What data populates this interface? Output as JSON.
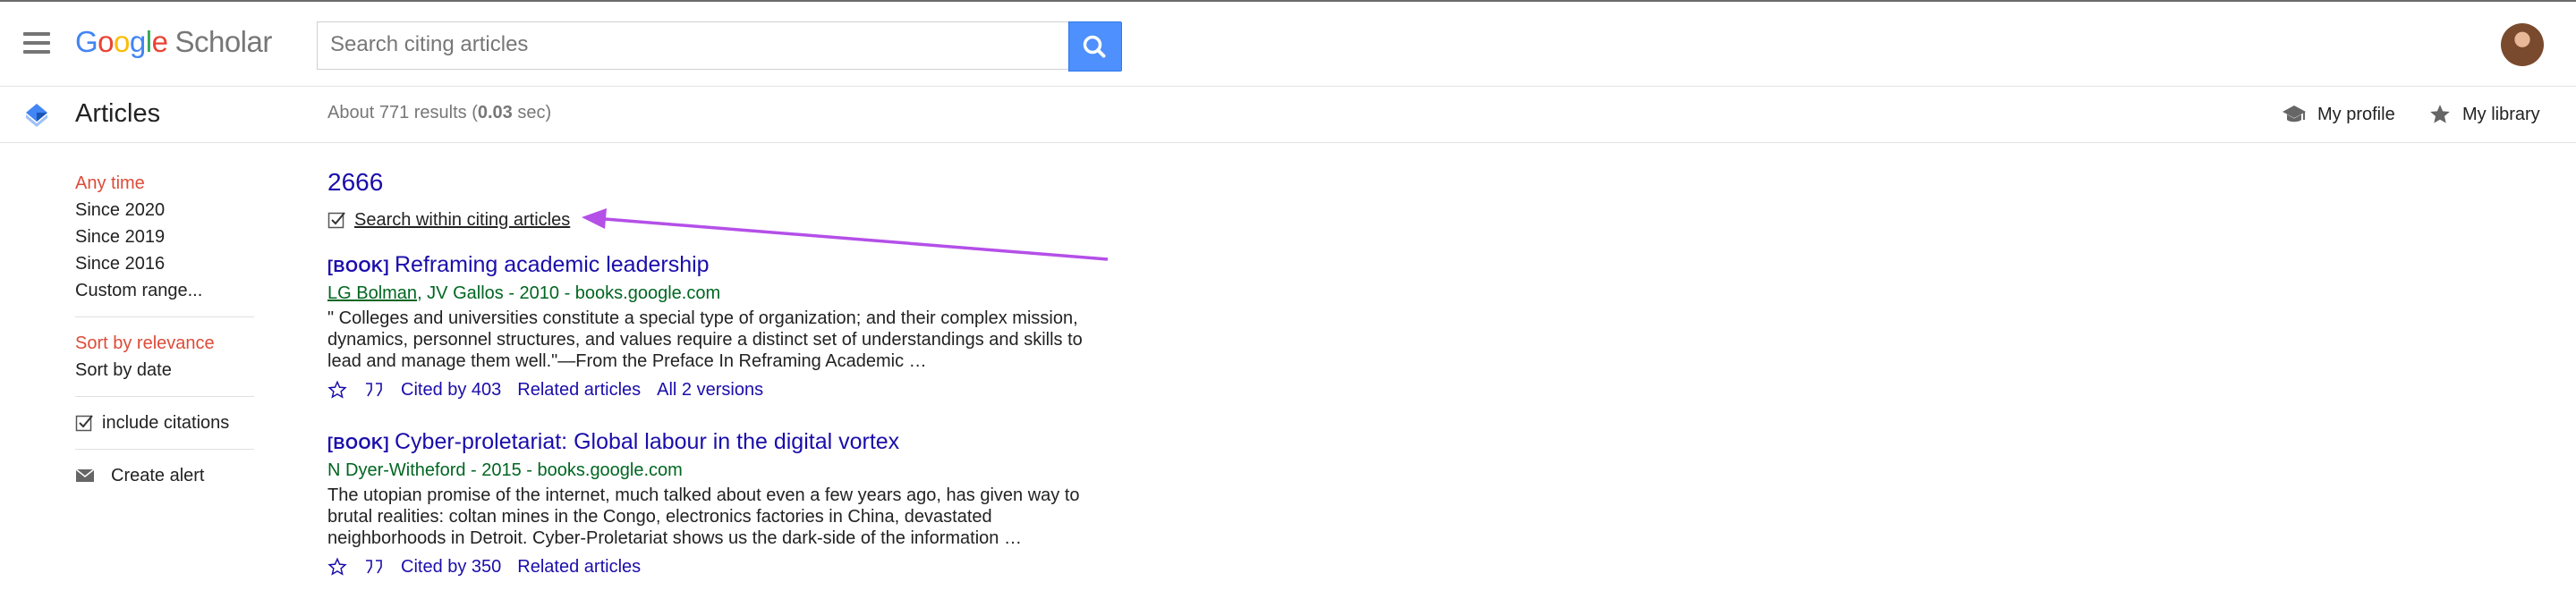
{
  "header": {
    "logo": {
      "g1": "G",
      "o1": "o",
      "o2": "o",
      "g2": "g",
      "l": "l",
      "e": "e",
      "scholar": "Scholar"
    },
    "search_placeholder": "Search citing articles",
    "search_icon": "search-icon",
    "menu_icon": "hamburger-menu-icon",
    "avatar": "user-avatar"
  },
  "subheader": {
    "section_label": "Articles",
    "results_prefix": "About 771 results (",
    "results_time": "0.03",
    "results_suffix": " sec)",
    "my_profile": "My profile",
    "my_library": "My library"
  },
  "sidebar": {
    "time_filters": [
      "Any time",
      "Since 2020",
      "Since 2019",
      "Since 2016",
      "Custom range..."
    ],
    "sort_options": [
      "Sort by relevance",
      "Sort by date"
    ],
    "include_citations": "include citations",
    "create_alert": "Create alert"
  },
  "main": {
    "cited_count": "2666",
    "search_within": "Search within citing articles",
    "results": [
      {
        "tag": "[BOOK]",
        "title": "Reframing academic leadership",
        "author_link": "LG Bolman",
        "author_rest": ", JV Gallos - 2010 - books.google.com",
        "snippet": "\" Colleges and universities constitute a special type of organization; and their complex mission, dynamics, personnel structures, and values require a distinct set of understandings and skills to lead and manage them well.\"—From the Preface In Reframing Academic …",
        "actions": {
          "cited_by": "Cited by 403",
          "related": "Related articles",
          "versions": "All 2 versions"
        }
      },
      {
        "tag": "[BOOK]",
        "title": "Cyber-proletariat: Global labour in the digital vortex",
        "author_link": "",
        "author_rest": "N Dyer-Witheford - 2015 - books.google.com",
        "snippet": "The utopian promise of the internet, much talked about even a few years ago, has given way to brutal realities: coltan mines in the Congo, electronics factories in China, devastated neighborhoods in Detroit. Cyber-Proletariat shows us the dark-side of the information …",
        "actions": {
          "cited_by": "Cited by 350",
          "related": "Related articles"
        }
      }
    ]
  },
  "colors": {
    "link": "#1a0dab",
    "active_filter": "#dd4b39",
    "author_green": "#006621",
    "search_button": "#4d90fe",
    "annotation_arrow": "#b44fe8"
  }
}
